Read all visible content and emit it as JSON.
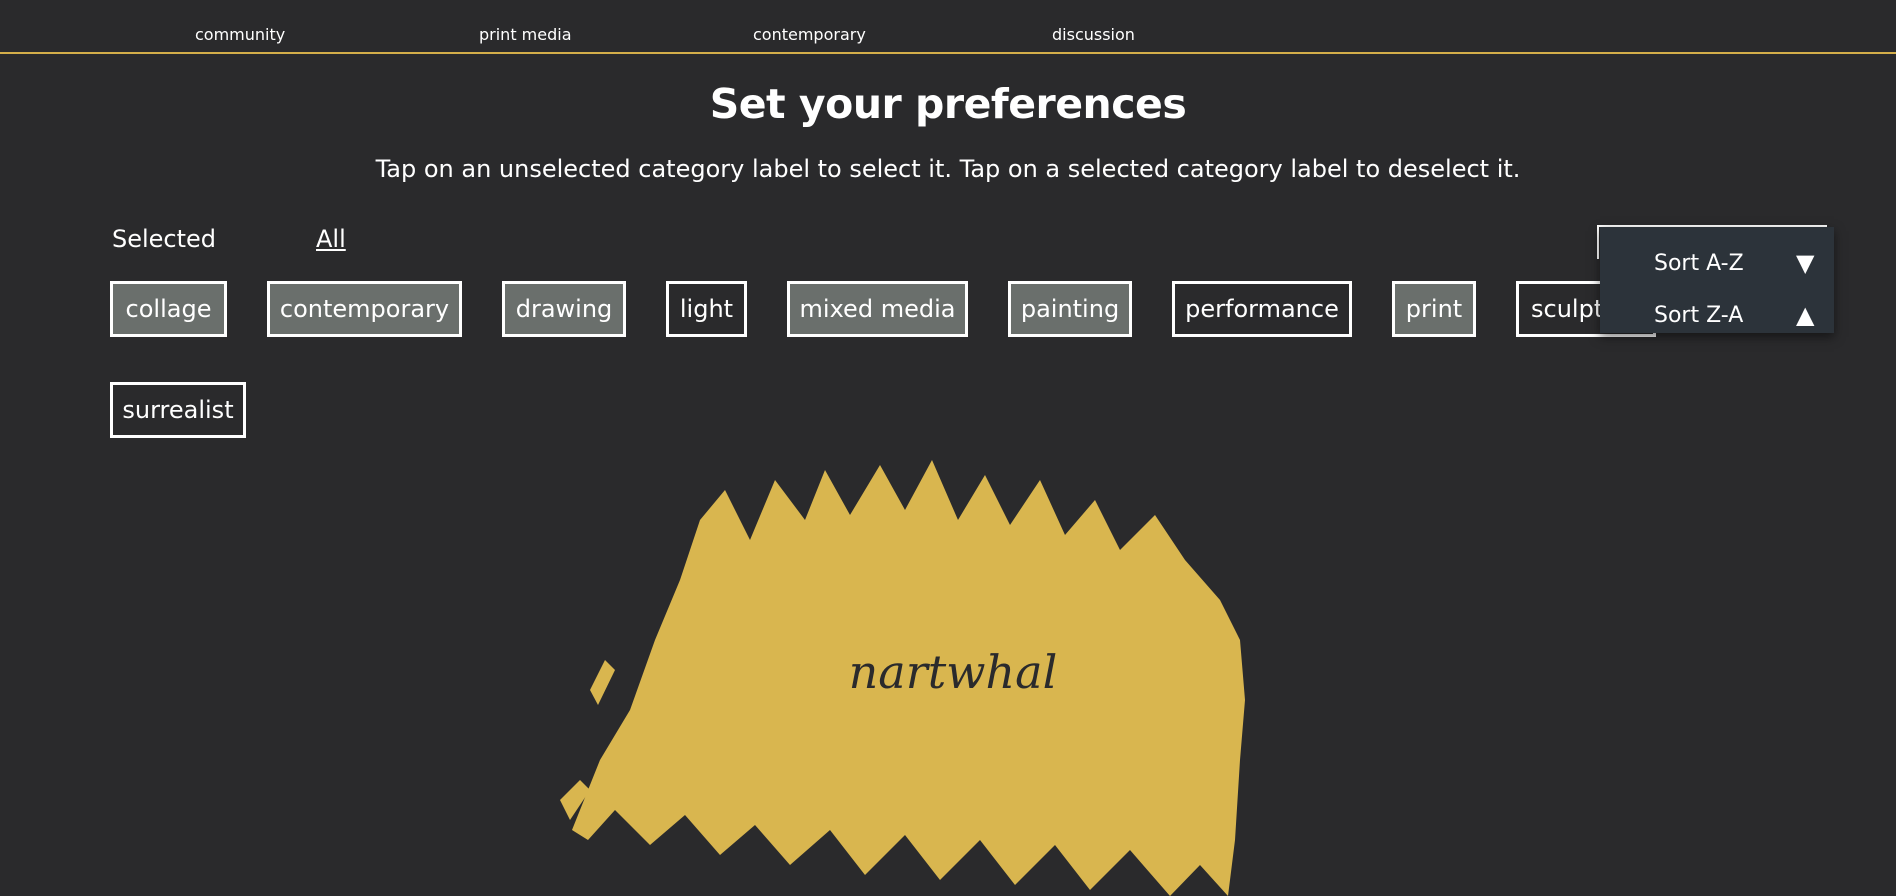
{
  "nav": {
    "items": [
      "community",
      "print media",
      "contemporary",
      "discussion"
    ]
  },
  "colors": {
    "background": "#2a2a2c",
    "accent": "#d4ae4a",
    "chip_selected": "#6a6f6c",
    "menu_bg": "#2c333a"
  },
  "page": {
    "title": "Set your preferences",
    "instructions": "Tap on an unselected category label to select it. Tap on a selected category label to deselect it."
  },
  "filters": {
    "selected": "Selected",
    "all": "All"
  },
  "categories": [
    {
      "label": "collage",
      "selected": true
    },
    {
      "label": "contemporary",
      "selected": true
    },
    {
      "label": "drawing",
      "selected": true
    },
    {
      "label": "light",
      "selected": false
    },
    {
      "label": "mixed media",
      "selected": true
    },
    {
      "label": "painting",
      "selected": true
    },
    {
      "label": "performance",
      "selected": false
    },
    {
      "label": "print",
      "selected": true
    },
    {
      "label": "sculpture",
      "selected": false
    },
    {
      "label": "surrealist",
      "selected": false
    }
  ],
  "sort_menu": {
    "options": [
      {
        "label": "Sort A-Z",
        "icon": "triangle-down-icon",
        "glyph": "▼"
      },
      {
        "label": "Sort Z-A",
        "icon": "triangle-up-icon",
        "glyph": "▲"
      }
    ]
  },
  "logo": {
    "wordmark": "nartwhal"
  }
}
